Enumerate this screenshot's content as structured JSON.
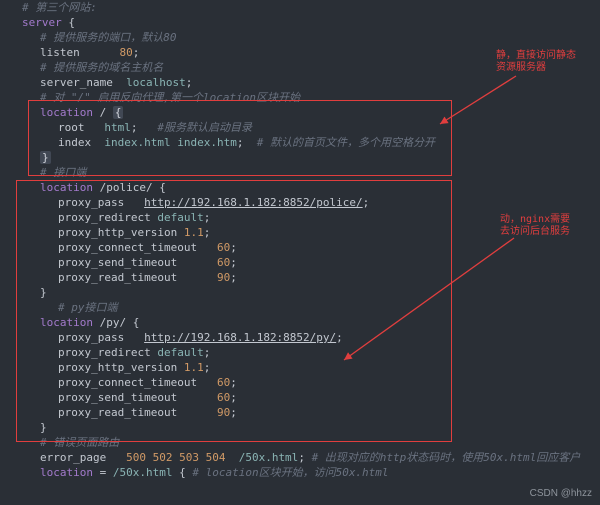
{
  "colors": {
    "bg": "#2a2f36",
    "box": "#e03e3e"
  },
  "annotations": {
    "top": "静，直接访问静态\n资源服务器",
    "bottom": "动，nginx需要\n去访问后台服务"
  },
  "watermark": "CSDN @hhzz",
  "code": {
    "l1_cmt": "# 第三个网站:",
    "l2_server": "server",
    "l2_brace": "{",
    "l3_cmt": "# 提供服务的端口，默认80",
    "l4_listen": "listen",
    "l4_val": "80",
    "l5_cmt": "# 提供服务的域名主机名",
    "l6_servername": "server_name",
    "l6_val": "localhost",
    "l7_cmt": "# 对 \"/\" 启用反向代理,第一个location区块开始",
    "l8_location": "location",
    "l8_path": "/",
    "l8_open": "{",
    "l9_root": "root",
    "l9_rootval": "html",
    "l9_cmt": "#服务默认启动目录",
    "l10_index": "index",
    "l10_indexval": "index.html index.htm",
    "l10_cmt": "# 默认的首页文件，多个用空格分开",
    "l11_close": "}",
    "l12_cmt": "# 接口端",
    "l13_location": "location",
    "l13_path": "/police/",
    "l13_open": "{",
    "l14_k": "proxy_pass",
    "l14_url": "http://192.168.1.182:8852/police/",
    "l15_k": "proxy_redirect",
    "l15_v": "default",
    "l16_k": "proxy_http_version",
    "l16_v": "1.1",
    "l17_k": "proxy_connect_timeout",
    "l17_v": "60",
    "l18_k": "proxy_send_timeout",
    "l18_v": "60",
    "l19_k": "proxy_read_timeout",
    "l19_v": "90",
    "l20_close": "}",
    "l21_cmt": "# py接口端",
    "l22_location": "location",
    "l22_path": "/py/",
    "l22_open": "{",
    "l23_k": "proxy_pass",
    "l23_url": "http://192.168.1.182:8852/py/",
    "l24_k": "proxy_redirect",
    "l24_v": "default",
    "l25_k": "proxy_http_version",
    "l25_v": "1.1",
    "l26_k": "proxy_connect_timeout",
    "l26_v": "60",
    "l27_k": "proxy_send_timeout",
    "l27_v": "60",
    "l28_k": "proxy_read_timeout",
    "l28_v": "90",
    "l29_close": "}",
    "l30_cmt": "# 错误页面路由",
    "l31_err": "error_page",
    "l31_codes": "500 502 503 504",
    "l31_page": "/50x.html",
    "l31_cmt": "# 出现对应的http状态码时，使用50x.html回应客户",
    "l32_location": "location",
    "l32_eq": "=",
    "l32_path": "/50x.html",
    "l32_open": "{",
    "l32_cmt": "# location区块开始，访问50x.html"
  }
}
